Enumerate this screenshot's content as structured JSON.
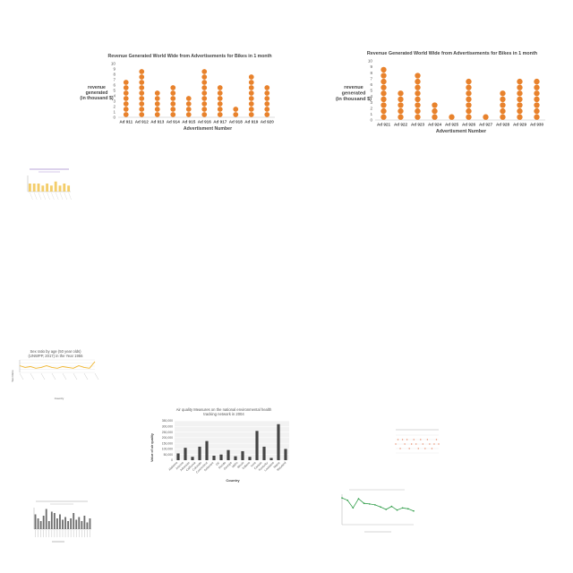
{
  "chart_data": [
    {
      "type": "bar",
      "title": "Revenue Generated World Wide from Advertisements for Bikes in 1 month",
      "xlabel": "Advertisment Number",
      "ylabel": "revenue generated (in thousand $)",
      "ylim": [
        0,
        10
      ],
      "yticks": [
        "0",
        "1",
        "2",
        "3",
        "4",
        "5",
        "6",
        "7",
        "8",
        "9",
        "10"
      ],
      "categories": [
        "Ad 911",
        "Ad 912",
        "Ad 913",
        "Ad 914",
        "Ad 915",
        "Ad 916",
        "Ad 917",
        "Ad 918",
        "Ad 919",
        "Ad 920"
      ],
      "values": [
        7,
        9,
        5,
        6,
        4,
        9,
        6,
        2,
        8,
        6
      ],
      "style": "stacked dots",
      "color": "#e8822c"
    },
    {
      "type": "bar",
      "title": "Revenue Generated World Wide from Advertisements for Bikes in 1 month",
      "xlabel": "Advertisment Number",
      "ylabel": "revenue generated (in thousand $)",
      "ylim": [
        0,
        10
      ],
      "yticks": [
        "0",
        "1",
        "2",
        "3",
        "4",
        "5",
        "6",
        "7",
        "8",
        "9",
        "10"
      ],
      "categories": [
        "Ad 921",
        "Ad 922",
        "Ad 923",
        "Ad 924",
        "Ad 925",
        "Ad 926",
        "Ad 927",
        "Ad 928",
        "Ad 929",
        "Ad 930"
      ],
      "values": [
        9,
        5,
        8,
        3,
        1,
        7,
        1,
        5,
        7,
        7
      ],
      "style": "stacked dots",
      "color": "#e8822c"
    },
    {
      "type": "bar",
      "categories": [
        "1",
        "2",
        "3",
        "4",
        "5",
        "6",
        "7",
        "8",
        "9",
        "10"
      ],
      "values": [
        4,
        4,
        4,
        3,
        4,
        3,
        5,
        3,
        4,
        3
      ],
      "color": "#f3cd6a"
    },
    {
      "type": "line",
      "title": "Sex ratio by age (50 year olds) (UNWPP, 2017) in the Year 1955",
      "xlabel": "Country",
      "ylabel": "Sex Ratio",
      "categories": [
        "1",
        "2",
        "3",
        "4",
        "5",
        "6",
        "7",
        "8",
        "9",
        "10",
        "11",
        "12",
        "13",
        "14",
        "15"
      ],
      "values": [
        103,
        101,
        102,
        100,
        101,
        103,
        101,
        100,
        102,
        101,
        100,
        103,
        101,
        100,
        108
      ],
      "color": "#f0b428"
    },
    {
      "type": "bar",
      "title": "Air quality Measures on the national environmental health tracking network in 2004",
      "xlabel": "Country",
      "ylabel": "Value of air quality",
      "ylim": [
        0,
        350000
      ],
      "yticks": [
        "0",
        "50,000",
        "100,000",
        "150,000",
        "200,000",
        "250,000",
        "300,000",
        "350,000"
      ],
      "categories": [
        "Alabama",
        "Arizona",
        "Arkansas",
        "California",
        "Colorado",
        "Connecticut",
        "Delaware",
        "DC",
        "Florida",
        "Georgia",
        "Idaho",
        "Illinois",
        "Indiana",
        "Iowa",
        "Kansas",
        "Kentucky",
        "Louisiana",
        "Maine",
        "Maryland"
      ],
      "values": [
        60000,
        110000,
        30000,
        120000,
        170000,
        40000,
        50000,
        90000,
        35000,
        80000,
        30000,
        260000,
        120000,
        20000,
        320000,
        100000
      ],
      "color": "#454545"
    },
    {
      "type": "scatter",
      "values": [
        2,
        3,
        1,
        3,
        2,
        3,
        1,
        2,
        3,
        2,
        1,
        3,
        2,
        1,
        3,
        2,
        1,
        2,
        3,
        2
      ],
      "color": "#e88a6a"
    },
    {
      "type": "bar",
      "categories": [
        "1",
        "2",
        "3",
        "4",
        "5",
        "6",
        "7",
        "8",
        "9",
        "10",
        "11",
        "12",
        "13",
        "14",
        "15",
        "16",
        "17",
        "18",
        "19",
        "20",
        "21"
      ],
      "values": [
        55,
        40,
        30,
        50,
        75,
        30,
        65,
        60,
        40,
        55,
        35,
        45,
        30,
        40,
        60,
        35,
        45,
        30,
        50,
        25,
        40
      ],
      "color": "#6e6e6e"
    },
    {
      "type": "line",
      "values": [
        88,
        80,
        55,
        85,
        70,
        68,
        65,
        58,
        50,
        60,
        48,
        55,
        52,
        45
      ],
      "color": "#2e9c47"
    }
  ]
}
